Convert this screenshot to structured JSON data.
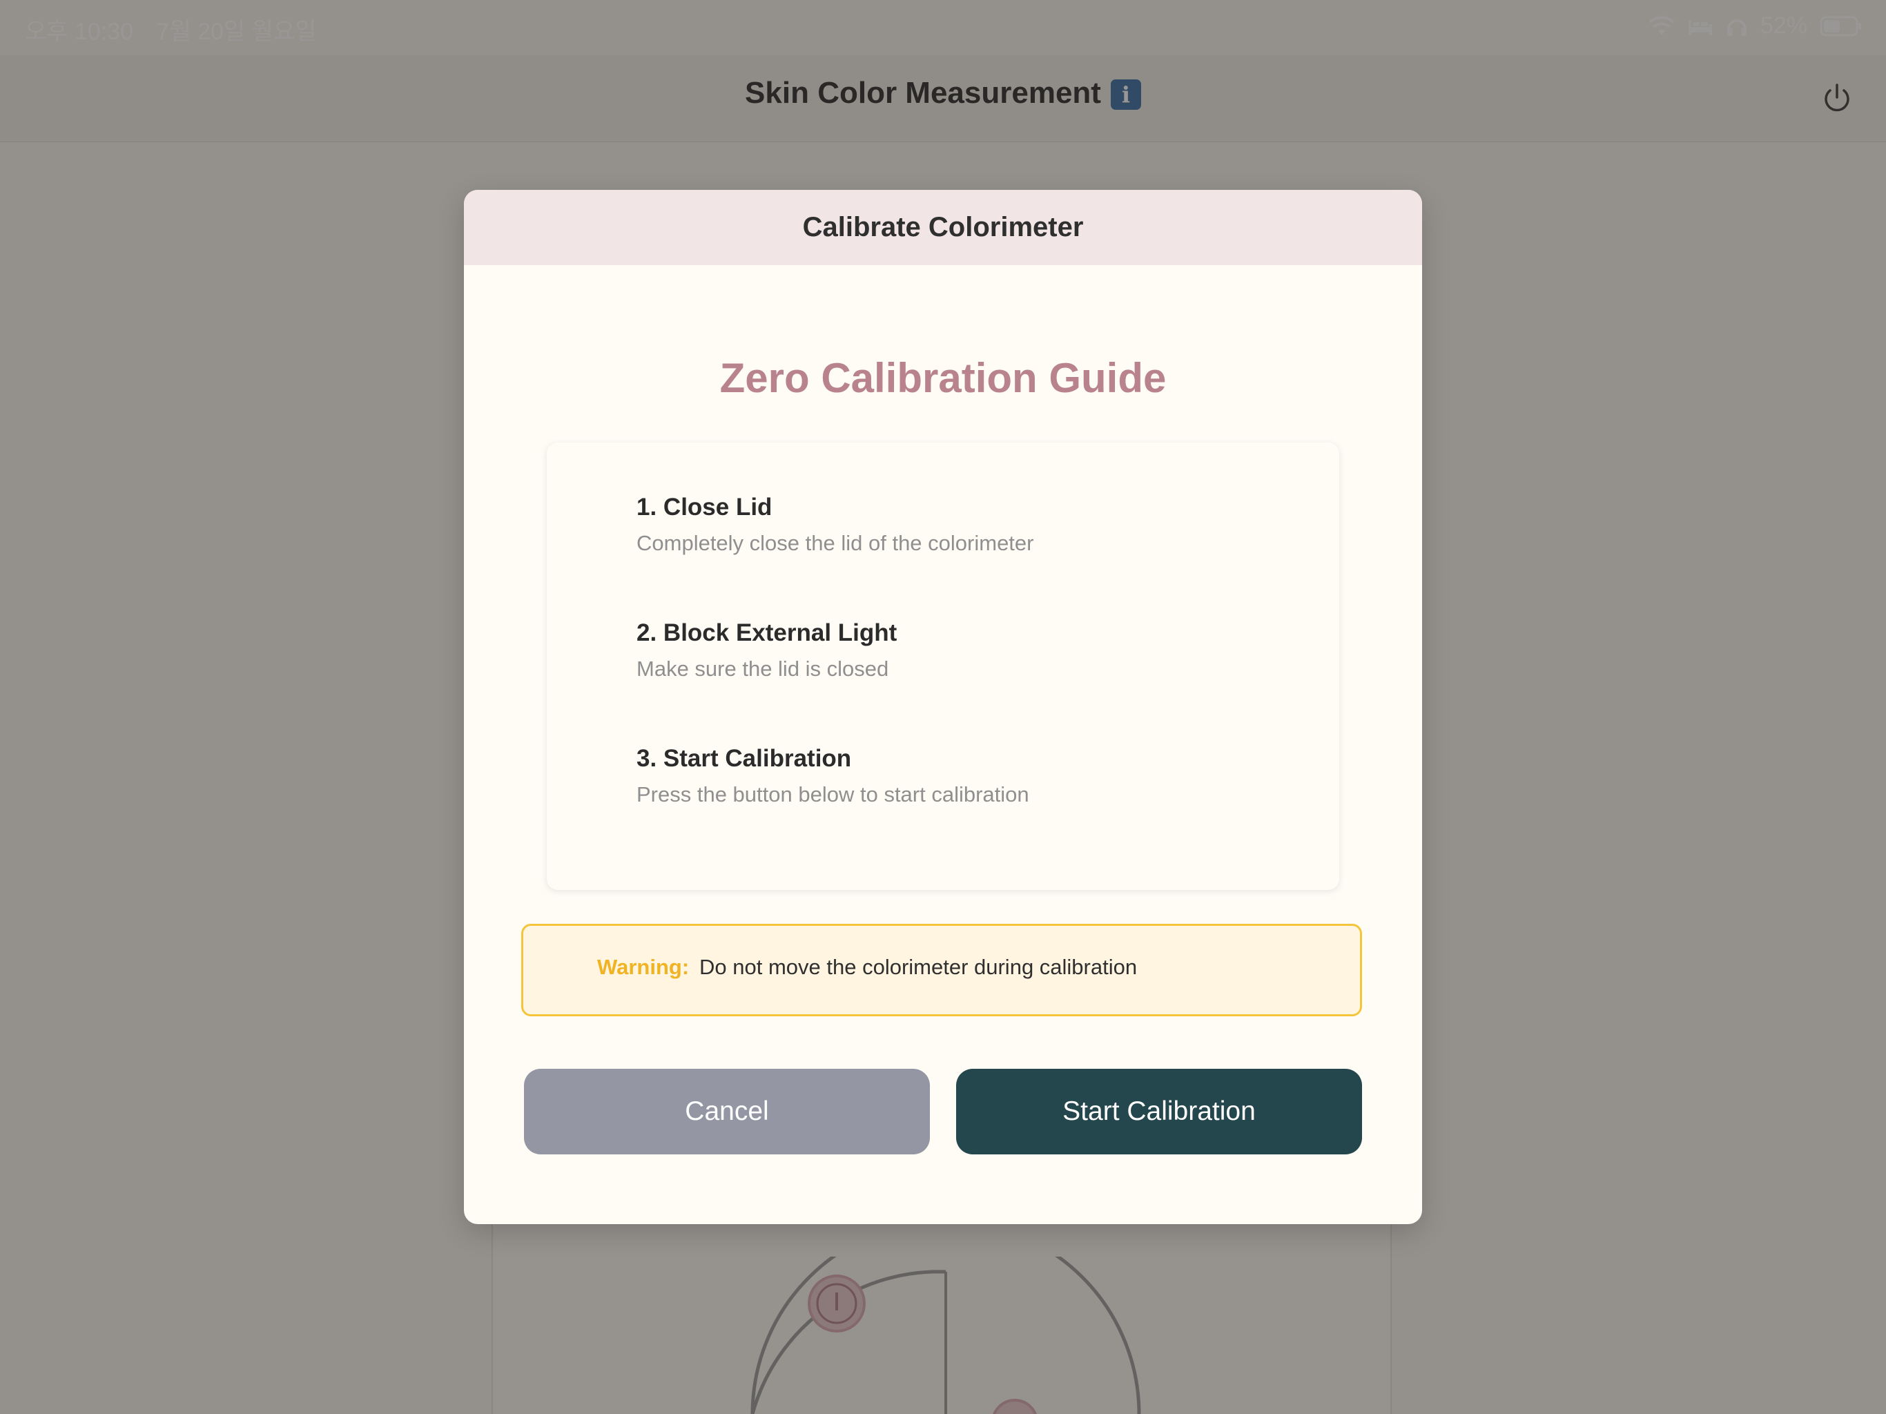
{
  "status_bar": {
    "time": "오후 10:30",
    "date": "7월 20일 월요일",
    "battery_percent": "52%",
    "icons": [
      "wifi-icon",
      "bed-icon",
      "headphones-icon",
      "battery-icon"
    ]
  },
  "header": {
    "title": "Skin Color Measurement",
    "info_icon_text": "i",
    "power_icon": "power-icon"
  },
  "modal": {
    "header_title": "Calibrate Colorimeter",
    "guide_title": "Zero Calibration Guide",
    "steps": [
      {
        "title": "1. Close Lid",
        "description": "Completely close the lid of the colorimeter"
      },
      {
        "title": "2. Block External Light",
        "description": "Make sure the lid is closed"
      },
      {
        "title": "3. Start Calibration",
        "description": "Press the button below to start calibration"
      }
    ],
    "warning": {
      "label": "Warning:",
      "text": "Do not move the colorimeter during calibration"
    },
    "buttons": {
      "cancel": "Cancel",
      "start": "Start Calibration"
    }
  },
  "colors": {
    "accent_title": "#b9838d",
    "primary_button": "#24464d",
    "cancel_button": "#9497a3",
    "warning_border": "#f4c53b",
    "warning_label": "#f0b323"
  }
}
